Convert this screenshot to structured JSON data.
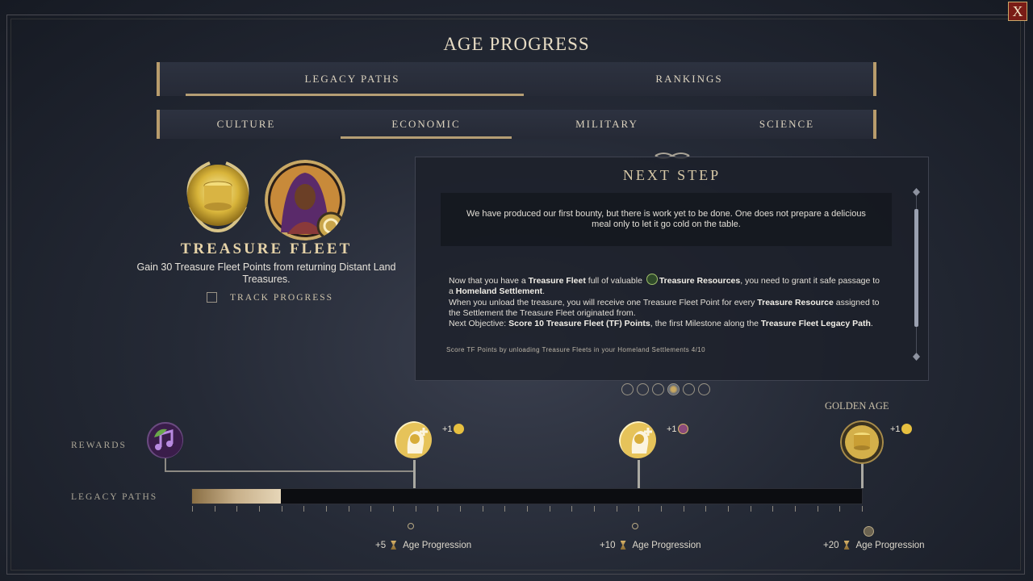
{
  "window": {
    "title": "AGE PROGRESS",
    "close_label": "X"
  },
  "main_tabs": [
    {
      "label": "LEGACY PATHS",
      "active": true
    },
    {
      "label": "RANKINGS",
      "active": false
    }
  ],
  "sub_tabs": [
    {
      "label": "CULTURE",
      "active": false
    },
    {
      "label": "ECONOMIC",
      "active": true
    },
    {
      "label": "MILITARY",
      "active": false
    },
    {
      "label": "SCIENCE",
      "active": false
    }
  ],
  "legacy": {
    "name": "TREASURE FLEET",
    "description": "Gain 30 Treasure Fleet Points from returning Distant Land Treasures.",
    "track_label": "TRACK PROGRESS",
    "track_checked": false
  },
  "next_step": {
    "title": "NEXT STEP",
    "quote": "We have produced our first bounty, but there is work yet to be done. One does not prepare a delicious meal only to let it go cold on the table.",
    "p1a": "Now that you have a ",
    "p1b": "Treasure Fleet",
    "p1c": " full of valuable ",
    "p1d": "Treasure Resources",
    "p1e": ", you need to grant it safe passage to a ",
    "p1f": "Homeland Settlement",
    "p1g": ".",
    "p2a": "When you unload the treasure, you will receive one Treasure Fleet Point for every ",
    "p2b": "Treasure Resource",
    "p2c": " assigned to the Settlement the Treasure Fleet originated from.",
    "p3a": "Next Objective: ",
    "p3b": "Score 10 Treasure Fleet (TF) Points",
    "p3c": ", the first Milestone along the ",
    "p3d": "Treasure Fleet Legacy Path",
    "p3e": ".",
    "hint": "Score TF Points by unloading Treasure Fleets in your Homeland Settlements 4/10"
  },
  "pagination": {
    "count": 6,
    "active_index": 3
  },
  "rewards_label": "REWARDS",
  "legacy_paths_label": "LEGACY PATHS",
  "golden_age_label": "GOLDEN AGE",
  "progress": {
    "current": 4,
    "max": 30,
    "fraction": 0.133
  },
  "milestones": [
    {
      "reward_icon": "culture-music-icon",
      "bonus": ""
    },
    {
      "reward_icon": "gold-head-icon",
      "bonus": "+1",
      "bonus_icon": "gold-coin-icon",
      "age": "+5",
      "age_label": "Age Progression"
    },
    {
      "reward_icon": "gold-head-icon",
      "bonus": "+1",
      "bonus_icon": "purple-chest-icon",
      "age": "+10",
      "age_label": "Age Progression"
    },
    {
      "reward_icon": "golden-age-coins-icon",
      "bonus": "+1",
      "bonus_icon": "gold-coin-icon",
      "age": "+20",
      "age_label": "Age Progression"
    }
  ],
  "colors": {
    "accent_gold": "#b59e74",
    "close_red": "#7a1c16"
  }
}
